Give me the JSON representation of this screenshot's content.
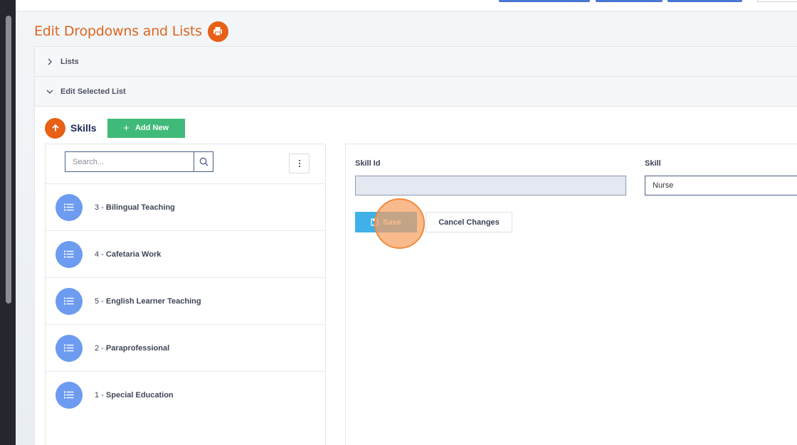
{
  "page": {
    "title": "Edit Dropdowns and Lists",
    "print_icon": "print-icon"
  },
  "accordion": {
    "lists_label": "Lists",
    "edit_selected_label": "Edit Selected List"
  },
  "skills_header": {
    "title": "Skills",
    "add_new_label": "Add New"
  },
  "search": {
    "placeholder": "Search...",
    "value": ""
  },
  "list_items": [
    {
      "id": "3",
      "name": "Bilingual Teaching"
    },
    {
      "id": "4",
      "name": "Cafetaria Work"
    },
    {
      "id": "5",
      "name": "English Learner Teaching"
    },
    {
      "id": "2",
      "name": "Paraprofessional"
    },
    {
      "id": "1",
      "name": "Special Education"
    }
  ],
  "form": {
    "skill_id_label": "Skill Id",
    "skill_id_value": "",
    "skill_label": "Skill",
    "skill_value": "Nurse",
    "save_label": "Save",
    "cancel_label": "Cancel Changes"
  },
  "colors": {
    "accent_orange": "#e85f16",
    "title_orange": "#e0651e",
    "add_green": "#3fba78",
    "save_blue": "#3fb0e8",
    "item_icon_blue": "#6c9bf0",
    "navy_text": "#1e2a5a"
  }
}
